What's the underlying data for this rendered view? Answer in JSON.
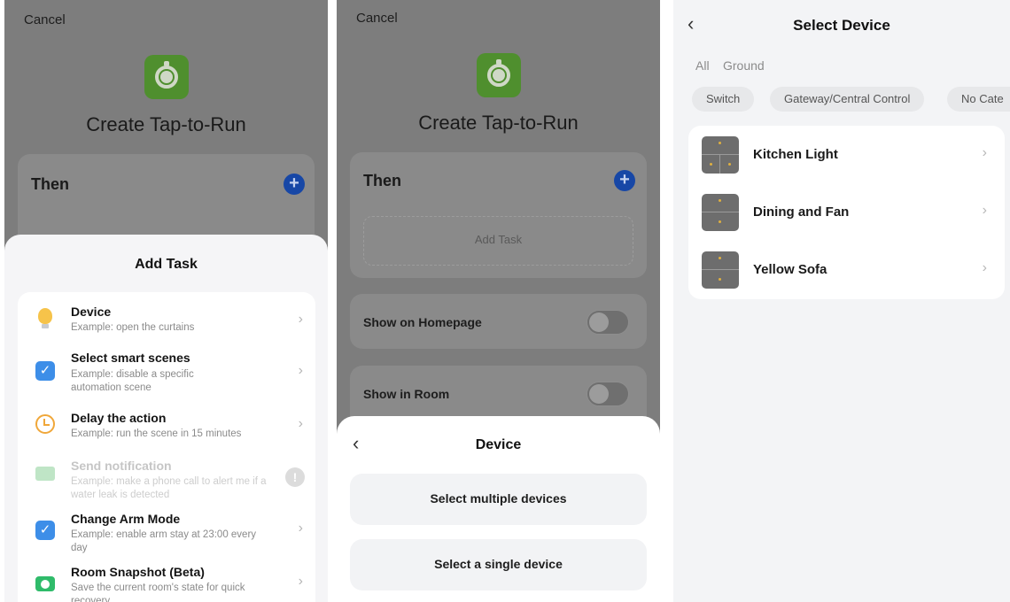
{
  "panel1": {
    "cancel": "Cancel",
    "title": "Create Tap-to-Run",
    "then": "Then",
    "sheet_title": "Add Task",
    "tasks": [
      {
        "title": "Device",
        "desc": "Example: open the curtains",
        "icon": "bulb-icon"
      },
      {
        "title": "Select smart scenes",
        "desc": "Example: disable a specific automation scene",
        "icon": "check-icon"
      },
      {
        "title": "Delay the action",
        "desc": "Example: run the scene in 15 minutes",
        "icon": "clock-icon"
      },
      {
        "title": "Send notification",
        "desc": "Example: make a phone call to alert me if a water leak is detected",
        "icon": "mail-icon",
        "disabled": true
      },
      {
        "title": "Change Arm Mode",
        "desc": "Example: enable arm stay at 23:00 every day",
        "icon": "check-icon"
      },
      {
        "title": "Room Snapshot (Beta)",
        "desc": "Save the current room's state for quick recovery",
        "icon": "camera-icon"
      }
    ]
  },
  "panel2": {
    "cancel": "Cancel",
    "title": "Create Tap-to-Run",
    "then": "Then",
    "add_task": "Add Task",
    "show_home": "Show on Homepage",
    "show_room": "Show in Room",
    "sheet_title": "Device",
    "btn_multiple": "Select multiple devices",
    "btn_single": "Select a single device"
  },
  "panel3": {
    "title": "Select Device",
    "filters": [
      "All",
      "Ground"
    ],
    "chips": [
      "Switch",
      "Gateway/Central Control",
      "No Cate"
    ],
    "devices": [
      "Kitchen Light",
      "Dining and Fan",
      "Yellow Sofa"
    ]
  },
  "colors": {
    "accent_blue": "#1c5fe0",
    "green_icon": "#5cb335"
  }
}
